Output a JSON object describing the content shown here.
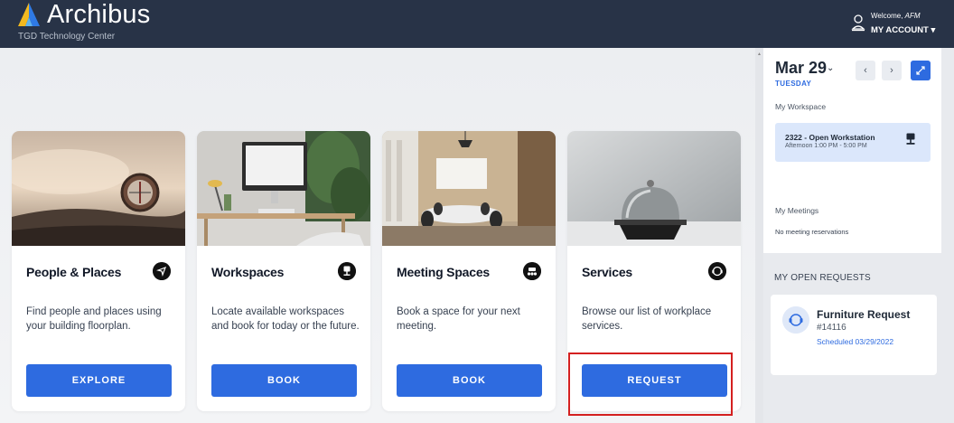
{
  "header": {
    "brand": "Archibus",
    "site": "TGD Technology Center",
    "welcome_prefix": "Welcome, ",
    "user": "AFM",
    "account_label": "MY ACCOUNT ▾"
  },
  "cards": [
    {
      "title": "People & Places",
      "description": "Find people and places using your building floorplan.",
      "button": "EXPLORE",
      "icon": "navigate-arrow-icon"
    },
    {
      "title": "Workspaces",
      "description": "Locate available workspaces and book for today or the future.",
      "button": "BOOK",
      "icon": "workstation-icon"
    },
    {
      "title": "Meeting Spaces",
      "description": "Book a space for your next meeting.",
      "button": "BOOK",
      "icon": "meeting-table-icon"
    },
    {
      "title": "Services",
      "description": "Browse our list of workplace services.",
      "button": "REQUEST",
      "icon": "service-headset-icon"
    }
  ],
  "calendar": {
    "date": "Mar 29",
    "weekday": "TUESDAY",
    "prev": "‹",
    "next": "›"
  },
  "workspace": {
    "label": "My Workspace",
    "title": "2322 - Open Workstation",
    "time": "Afternoon 1:00 PM - 5:00 PM"
  },
  "meetings": {
    "label": "My Meetings",
    "empty": "No meeting reservations"
  },
  "requests": {
    "heading": "MY OPEN REQUESTS",
    "items": [
      {
        "title": "Furniture Request",
        "number": "#14116",
        "status": "Scheduled 03/29/2022"
      }
    ]
  },
  "colors": {
    "header_bg": "#283347",
    "accent": "#2e6be0",
    "highlight": "#d42020"
  }
}
